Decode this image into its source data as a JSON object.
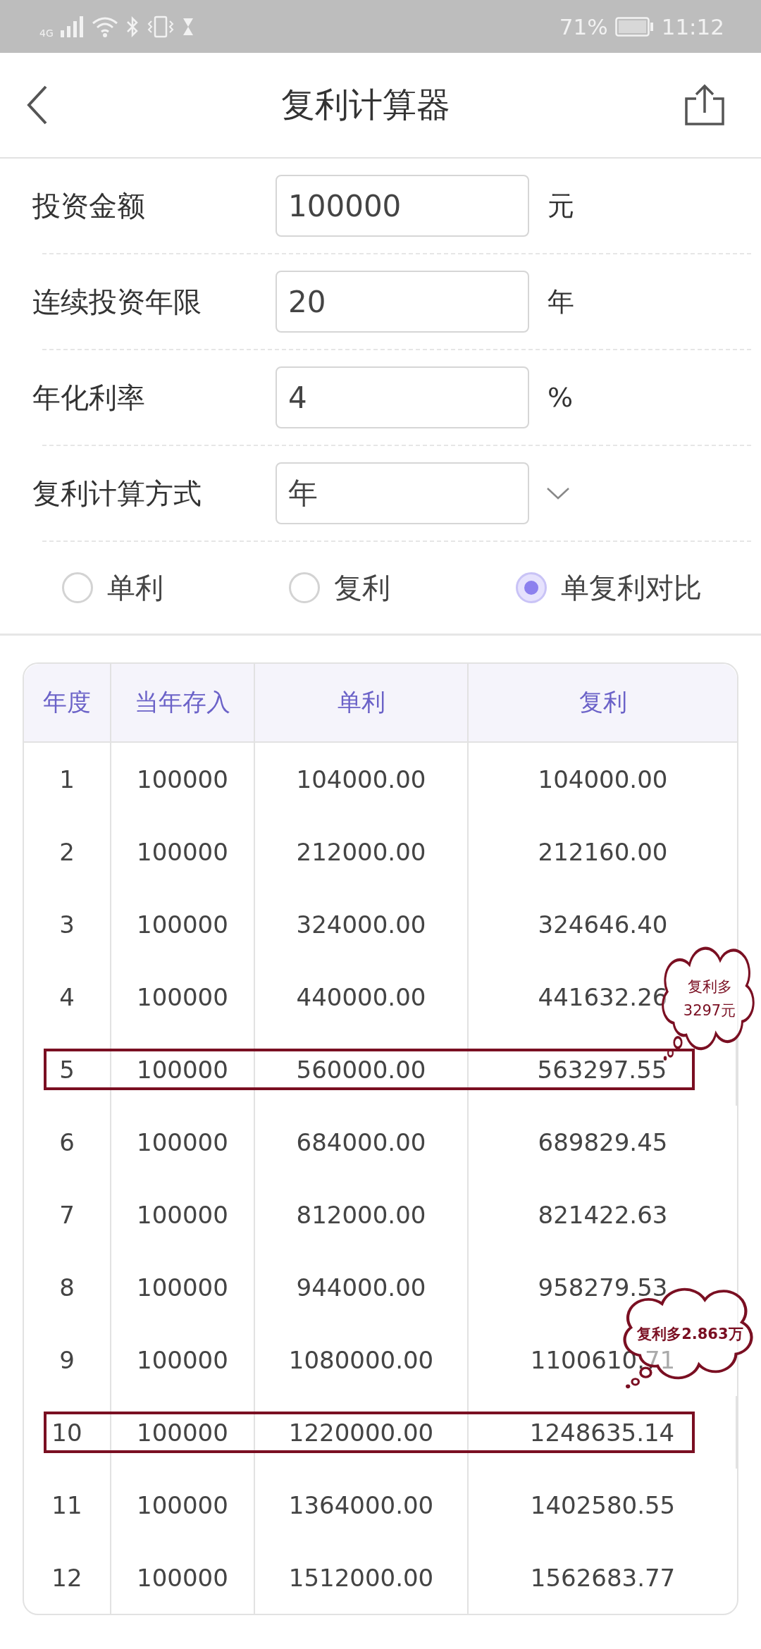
{
  "status_bar": {
    "network": "4G",
    "battery_percent": "71%",
    "time": "11:12"
  },
  "header": {
    "title": "复利计算器"
  },
  "form": [
    {
      "kind": "input",
      "label": "投资金额",
      "value": "100000",
      "unit": "元"
    },
    {
      "kind": "input",
      "label": "连续投资年限",
      "value": "20",
      "unit": "年"
    },
    {
      "kind": "input",
      "label": "年化利率",
      "value": "4",
      "unit": "%"
    },
    {
      "kind": "select",
      "label": "复利计算方式",
      "value": "年"
    }
  ],
  "modes": [
    {
      "label": "单利",
      "selected": false
    },
    {
      "label": "复利",
      "selected": false
    },
    {
      "label": "单复利对比",
      "selected": true
    }
  ],
  "table": {
    "columns": [
      "年度",
      "当年存入",
      "单利",
      "复利"
    ],
    "rows": [
      {
        "cells": [
          "1",
          "100000",
          "104000.00",
          "104000.00"
        ],
        "highlighted": false
      },
      {
        "cells": [
          "2",
          "100000",
          "212000.00",
          "212160.00"
        ],
        "highlighted": false
      },
      {
        "cells": [
          "3",
          "100000",
          "324000.00",
          "324646.40"
        ],
        "highlighted": false
      },
      {
        "cells": [
          "4",
          "100000",
          "440000.00",
          "441632.26"
        ],
        "highlighted": false
      },
      {
        "cells": [
          "5",
          "100000",
          "560000.00",
          "563297.55"
        ],
        "highlighted": true,
        "callout": [
          "复利多",
          "3297元"
        ]
      },
      {
        "cells": [
          "6",
          "100000",
          "684000.00",
          "689829.45"
        ],
        "highlighted": false
      },
      {
        "cells": [
          "7",
          "100000",
          "812000.00",
          "821422.63"
        ],
        "highlighted": false
      },
      {
        "cells": [
          "8",
          "100000",
          "944000.00",
          "958279.53"
        ],
        "highlighted": false
      },
      {
        "cells": [
          "9",
          "100000",
          "1080000.00",
          "1100610.71"
        ],
        "highlighted": false
      },
      {
        "cells": [
          "10",
          "100000",
          "1220000.00",
          "1248635.14"
        ],
        "highlighted": true,
        "callout": [
          "复利多2.863万"
        ]
      },
      {
        "cells": [
          "11",
          "100000",
          "1364000.00",
          "1402580.55"
        ],
        "highlighted": false
      },
      {
        "cells": [
          "12",
          "100000",
          "1512000.00",
          "1562683.77"
        ],
        "highlighted": false
      }
    ]
  }
}
